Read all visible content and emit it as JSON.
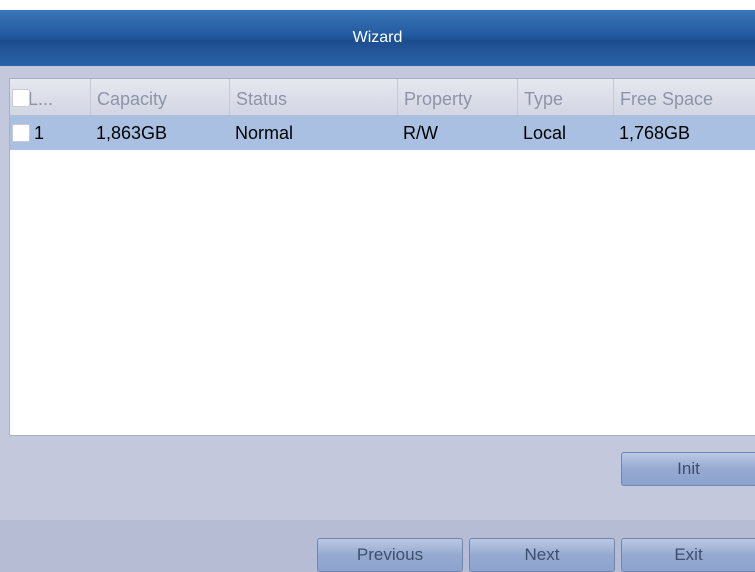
{
  "window": {
    "title": "Wizard"
  },
  "table": {
    "columns": [
      "L...",
      "Capacity",
      "Status",
      "Property",
      "Type",
      "Free Space"
    ],
    "rows": [
      {
        "label": "1",
        "capacity": "1,863GB",
        "status": "Normal",
        "property": "R/W",
        "type": "Local",
        "free_space": "1,768GB",
        "checked": false,
        "selected": true
      }
    ]
  },
  "actions": {
    "init_label": "Init"
  },
  "footer": {
    "previous_label": "Previous",
    "next_label": "Next",
    "exit_label": "Exit"
  },
  "colors": {
    "title_bar": "#2259a0",
    "selected_row": "#a9c0e2",
    "button": "#95a9d0",
    "background": "#c3c8dc"
  }
}
